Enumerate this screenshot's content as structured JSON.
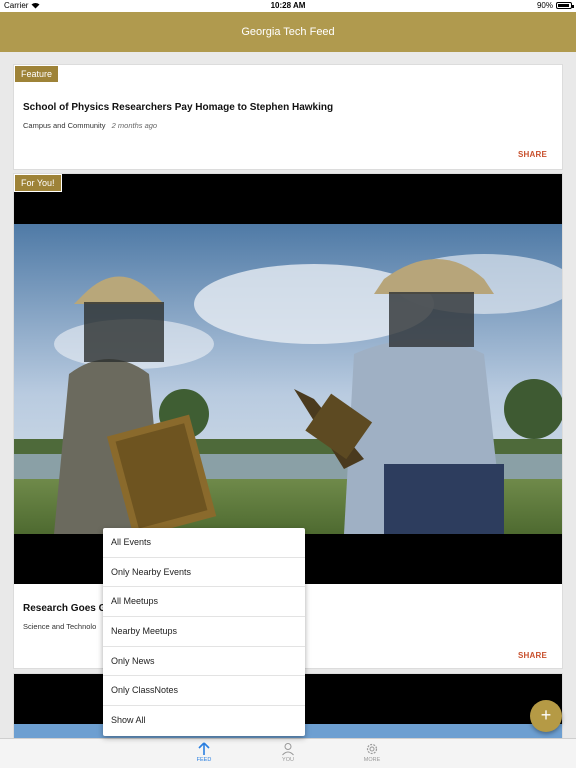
{
  "status_bar": {
    "carrier": "Carrier",
    "time": "10:28 AM",
    "battery": "90%"
  },
  "nav": {
    "title": "Georgia Tech Feed"
  },
  "feed": [
    {
      "badge": "Feature",
      "title": "School of Physics Researchers Pay Homage to Stephen Hawking",
      "category": "Campus and Community",
      "ago": "2 months ago",
      "share": "SHARE"
    },
    {
      "badge": "For You!",
      "title": "Research Goes G",
      "category": "Science and Technolo",
      "share": "SHARE"
    }
  ],
  "menu": {
    "items": [
      "All Events",
      "Only Nearby Events",
      "All Meetups",
      "Nearby Meetups",
      "Only News",
      "Only ClassNotes",
      "Show All"
    ]
  },
  "tab_bar": {
    "tabs": [
      {
        "label": "FEED",
        "icon": "arrow-up-icon",
        "active": true
      },
      {
        "label": "YOU",
        "icon": "person-icon",
        "active": false
      },
      {
        "label": "MORE",
        "icon": "gear-icon",
        "active": false
      }
    ]
  },
  "fab": {
    "label": "+"
  },
  "colors": {
    "brand_gold": "#b09a4e",
    "badge_gold": "#9e8338",
    "share": "#c8502d",
    "tab_active": "#2a7fe0"
  }
}
